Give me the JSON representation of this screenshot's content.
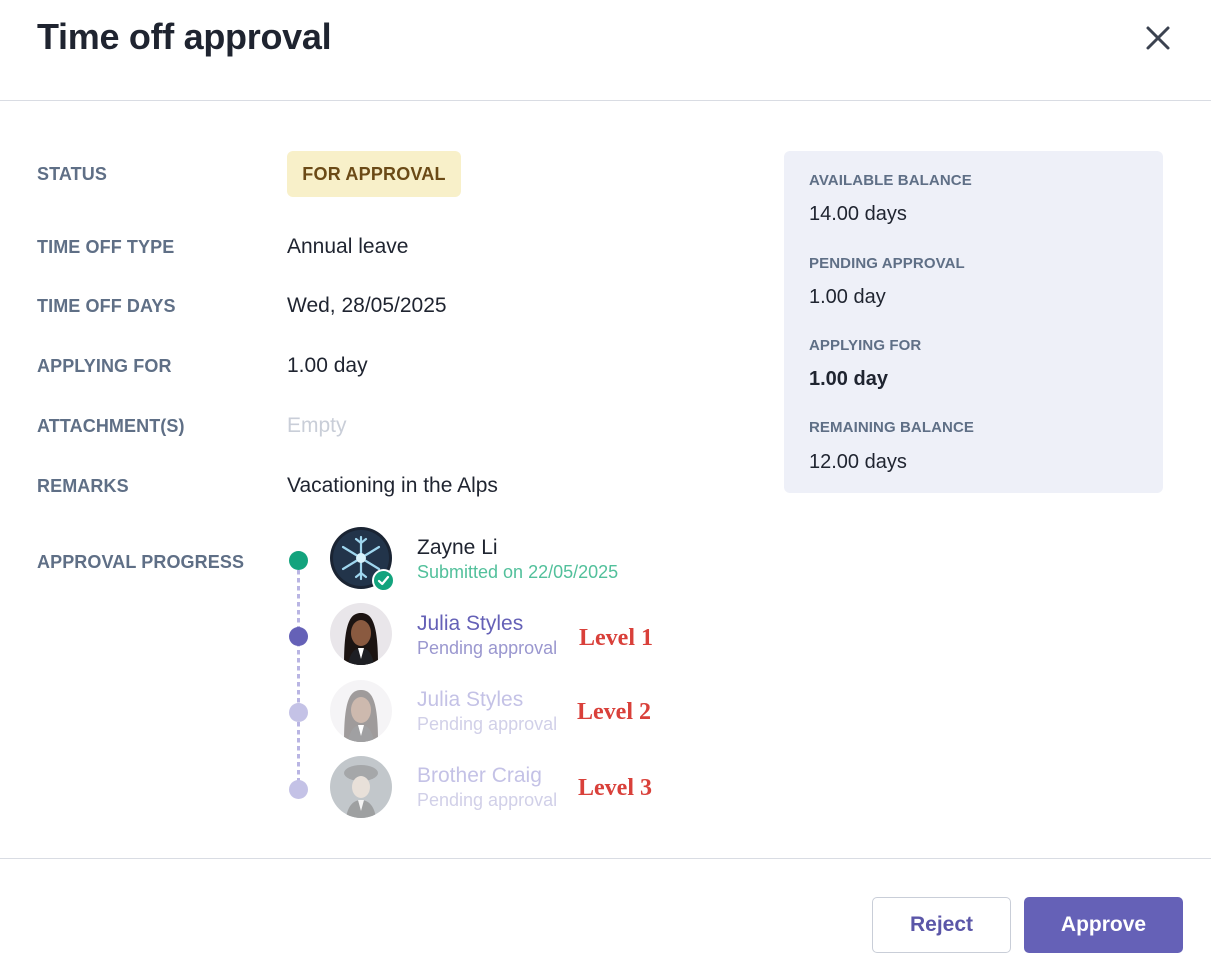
{
  "dialog": {
    "title": "Time off approval",
    "close_icon": "close-icon"
  },
  "details": {
    "status_label": "STATUS",
    "status_value": "FOR APPROVAL",
    "type_label": "TIME OFF TYPE",
    "type_value": "Annual leave",
    "days_label": "TIME OFF DAYS",
    "days_value": "Wed, 28/05/2025",
    "applying_label": "APPLYING FOR",
    "applying_value": "1.00 day",
    "attachments_label": "ATTACHMENT(S)",
    "attachments_value": "Empty",
    "remarks_label": "REMARKS",
    "remarks_value": "Vacationing in the Alps",
    "progress_label": "APPROVAL PROGRESS"
  },
  "balance": {
    "available_label": "AVAILABLE BALANCE",
    "available_value": "14.00 days",
    "pending_label": "PENDING APPROVAL",
    "pending_value": "1.00 day",
    "applying_label": "APPLYING FOR",
    "applying_value": "1.00 day",
    "remaining_label": "REMAINING BALANCE",
    "remaining_value": "12.00 days"
  },
  "approval": {
    "steps": [
      {
        "name": "Zayne Li",
        "sub": "Submitted on 22/05/2025",
        "level": ""
      },
      {
        "name": "Julia Styles",
        "sub": "Pending approval",
        "level": "Level 1"
      },
      {
        "name": "Julia Styles",
        "sub": "Pending approval",
        "level": "Level 2"
      },
      {
        "name": "Brother Craig",
        "sub": "Pending approval",
        "level": "Level 3"
      }
    ]
  },
  "actions": {
    "reject_label": "Reject",
    "approve_label": "Approve"
  },
  "colors": {
    "accent": "#6561b7",
    "success": "#13a37d",
    "badge_bg": "#f8f0c9",
    "badge_text": "#6b4a16",
    "level_annotation": "#d9403a"
  }
}
